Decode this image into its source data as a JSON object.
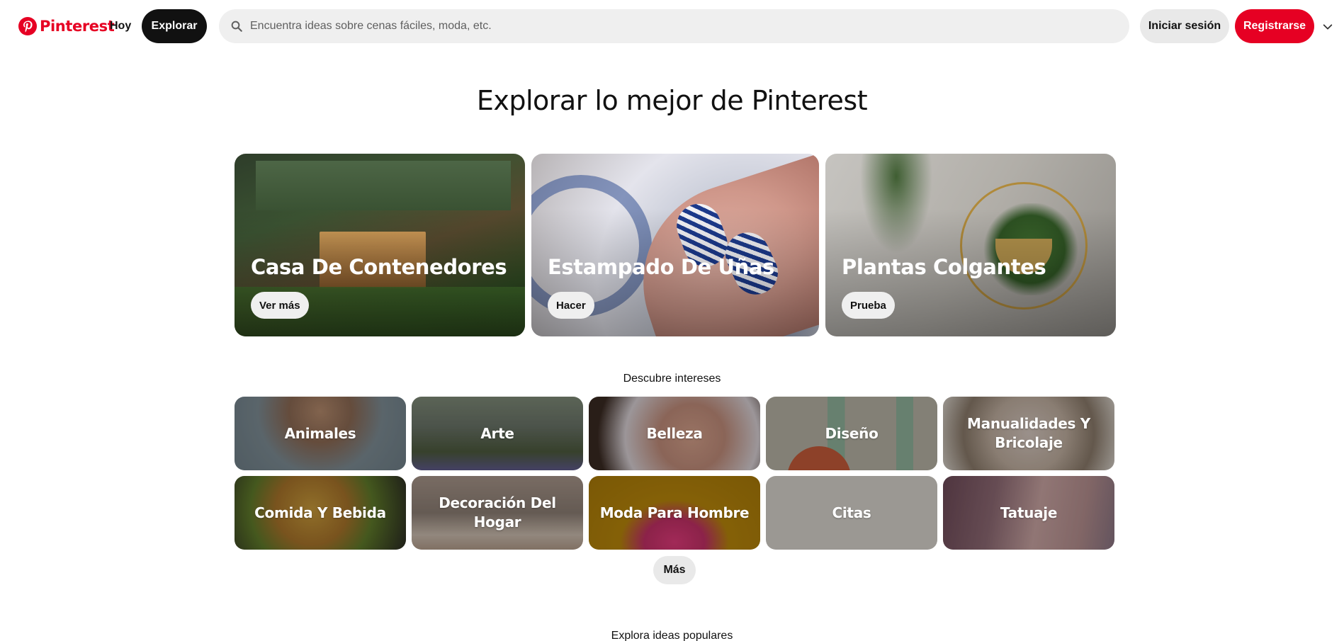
{
  "header": {
    "logo_text": "Pinterest",
    "nav_today": "Hoy",
    "nav_explore": "Explorar",
    "search_placeholder": "Encuentra ideas sobre cenas fáciles, moda, etc.",
    "login_label": "Iniciar sesión",
    "signup_label": "Registrarse",
    "brand_color": "#e60023"
  },
  "main": {
    "title": "Explorar lo mejor de Pinterest",
    "hero_cards": [
      {
        "title": "Casa De Contenedores",
        "button": "Ver más"
      },
      {
        "title": "Estampado De Uñas",
        "button": "Hacer"
      },
      {
        "title": "Plantas Colgantes",
        "button": "Prueba"
      }
    ],
    "interests_label": "Descubre intereses",
    "interests": [
      {
        "label": "Animales"
      },
      {
        "label": "Arte"
      },
      {
        "label": "Belleza"
      },
      {
        "label": "Diseño"
      },
      {
        "label": "Manualidades Y Bricolaje"
      },
      {
        "label": "Comida Y Bebida"
      },
      {
        "label": "Decoración Del Hogar"
      },
      {
        "label": "Moda Para Hombre"
      },
      {
        "label": "Citas"
      },
      {
        "label": "Tatuaje"
      }
    ],
    "more_label": "Más",
    "popular_label": "Explora ideas populares"
  },
  "icons": {
    "logo": "pinterest-logo-icon",
    "search": "search-icon",
    "menu": "chevron-down-icon"
  }
}
